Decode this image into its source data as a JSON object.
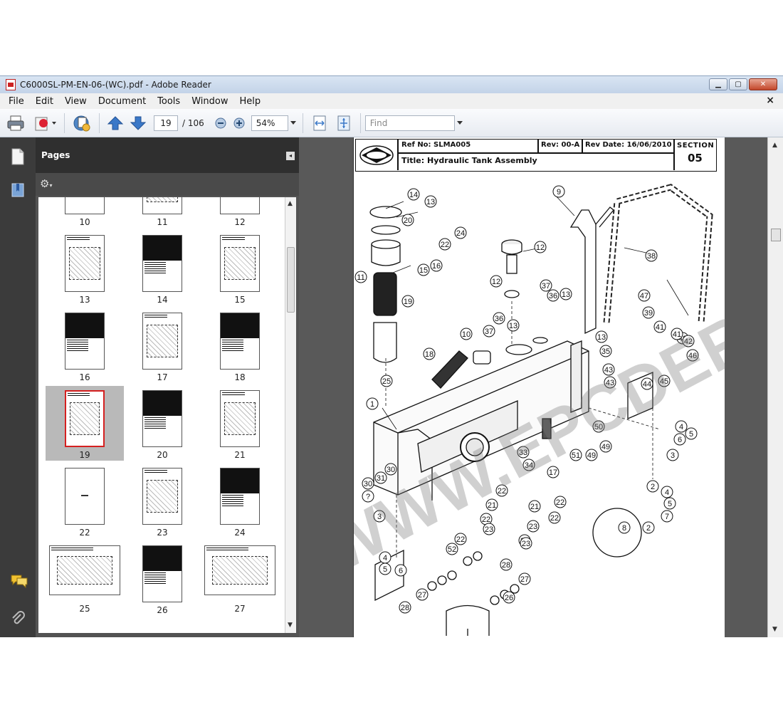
{
  "window": {
    "title": "C6000SL-PM-EN-06-(WC).pdf - Adobe Reader",
    "controls": [
      "minimize",
      "maximize",
      "close"
    ]
  },
  "menu": {
    "items": [
      "File",
      "Edit",
      "View",
      "Document",
      "Tools",
      "Window",
      "Help"
    ],
    "close_glyph": "×"
  },
  "toolbar": {
    "current_page": "19",
    "total_pages": "/ 106",
    "zoom": "54%",
    "find_placeholder": "Find"
  },
  "pages_panel": {
    "title": "Pages",
    "selected_page": 19,
    "thumbnails": [
      {
        "label": "10",
        "kind": "table"
      },
      {
        "label": "11",
        "kind": "drawing"
      },
      {
        "label": "12",
        "kind": "table"
      },
      {
        "label": "13",
        "kind": "drawing"
      },
      {
        "label": "14",
        "kind": "table"
      },
      {
        "label": "15",
        "kind": "drawing"
      },
      {
        "label": "16",
        "kind": "table"
      },
      {
        "label": "17",
        "kind": "drawing"
      },
      {
        "label": "18",
        "kind": "table"
      },
      {
        "label": "19",
        "kind": "drawing"
      },
      {
        "label": "20",
        "kind": "table"
      },
      {
        "label": "21",
        "kind": "drawing"
      },
      {
        "label": "22",
        "kind": "blank"
      },
      {
        "label": "23",
        "kind": "drawing"
      },
      {
        "label": "24",
        "kind": "table"
      },
      {
        "label": "25",
        "kind": "landscape"
      },
      {
        "label": "26",
        "kind": "table"
      },
      {
        "label": "27",
        "kind": "landscape"
      }
    ]
  },
  "document": {
    "ref_no": "Ref No: SLMA005",
    "rev": "Rev: 00-A",
    "rev_date": "Rev Date: 16/06/2010",
    "section_label": "SECTION",
    "section_number": "05",
    "title": "Title: Hydraulic Tank Assembly",
    "watermark": "WWW.EPCDERO.COM",
    "callouts": [
      "14",
      "13",
      "20",
      "24",
      "22",
      "16",
      "15",
      "11",
      "19",
      "9",
      "12",
      "12",
      "37",
      "36",
      "13",
      "38",
      "47",
      "39",
      "48",
      "10",
      "37",
      "36",
      "13",
      "13",
      "35",
      "41",
      "41",
      "42",
      "46",
      "18",
      "43",
      "43",
      "44",
      "45",
      "25",
      "1",
      "50",
      "49",
      "49",
      "51",
      "4",
      "5",
      "6",
      "3",
      "33",
      "34",
      "17",
      "30",
      "31",
      "30",
      "?",
      "3",
      "22",
      "21",
      "22",
      "22",
      "21",
      "22",
      "23",
      "22",
      "2",
      "4",
      "5",
      "7",
      "8",
      "2",
      "23",
      "22",
      "52",
      "23",
      "28",
      "27",
      "4",
      "5",
      "6",
      "27",
      "26",
      "28"
    ]
  },
  "colors": {
    "window_chrome": "#dfe6ee",
    "panel_dark": "#2f2f2f",
    "doc_background": "#595959",
    "selection_border": "#d42020"
  }
}
